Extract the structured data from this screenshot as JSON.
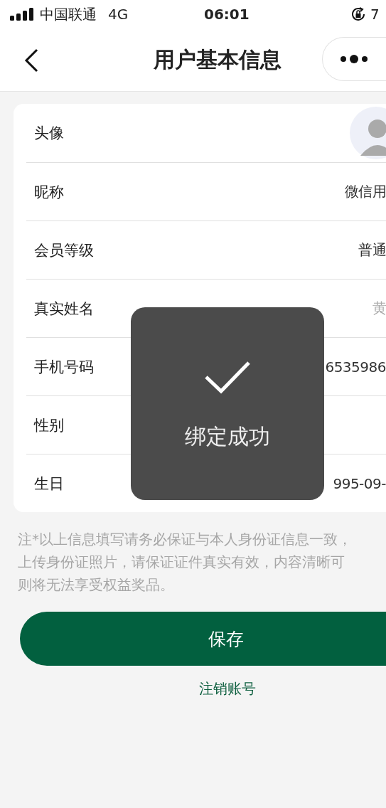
{
  "status_bar": {
    "carrier": "中国联通",
    "network": "4G",
    "time": "06:01",
    "battery": "7"
  },
  "header": {
    "title": "用户基本信息"
  },
  "rows": [
    {
      "kind": "avatar",
      "label": "头像"
    },
    {
      "kind": "text",
      "label": "昵称",
      "value": "微信用",
      "muted": false
    },
    {
      "kind": "text",
      "label": "会员等级",
      "value": "普通",
      "muted": false
    },
    {
      "kind": "text",
      "label": "真实姓名",
      "value": "黄",
      "muted": true
    },
    {
      "kind": "text",
      "label": "手机号码",
      "value": "6535986",
      "muted": false
    },
    {
      "kind": "text",
      "label": "性别"
    },
    {
      "kind": "text",
      "label": "生日",
      "value": "995-09-",
      "muted": false
    }
  ],
  "note": {
    "lines": [
      "注*以上信息填写请务必保证与本人身份证信息一致，",
      "上传身份证照片，请保证证件真实有效，内容清晰可",
      "则将无法享受权益奖品。"
    ]
  },
  "save_button": {
    "label": "保存"
  },
  "cancel_link": {
    "label": "注销账号"
  },
  "toast": {
    "message": "绑定成功"
  }
}
